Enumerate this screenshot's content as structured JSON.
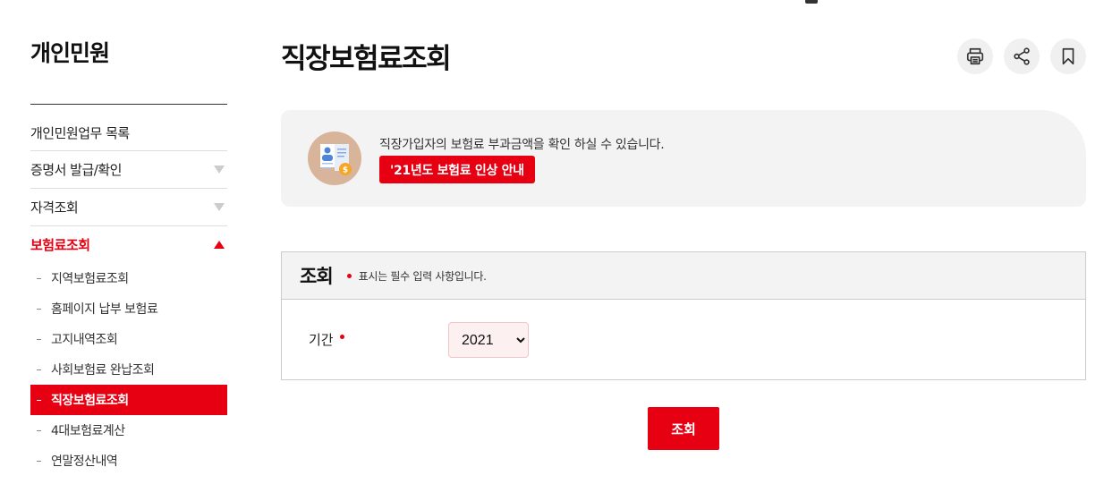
{
  "colors": {
    "accent": "#e60012",
    "panel": "#f3f3f3",
    "select_bg": "#fdf0f0"
  },
  "sidebar": {
    "title": "개인민원",
    "menu": [
      {
        "label": "개인민원업무 목록",
        "has_arrow": false
      },
      {
        "label": "증명서 발급/확인",
        "has_arrow": true
      },
      {
        "label": "자격조회",
        "has_arrow": true
      },
      {
        "label": "보험료조회",
        "has_arrow": true,
        "open": true
      }
    ],
    "submenu": [
      {
        "label": "지역보험료조회"
      },
      {
        "label": "홈페이지 납부 보험료"
      },
      {
        "label": "고지내역조회"
      },
      {
        "label": "사회보험료 완납조회"
      },
      {
        "label": "직장보험료조회",
        "active": true
      },
      {
        "label": "4대보험료계산"
      },
      {
        "label": "연말정산내역"
      }
    ]
  },
  "page": {
    "title": "직장보험료조회",
    "tools": {
      "print_icon": "printer-icon",
      "share_icon": "share-icon",
      "bookmark_icon": "bookmark-icon"
    }
  },
  "info": {
    "text": "직장가입자의 보험료 부과금액을 확인 하실 수 있습니다.",
    "button": "'21년도 보험료 인상 안내",
    "icon": "document-coin-icon"
  },
  "form": {
    "title": "조회",
    "required_note": "표시는 필수 입력 사항입니다.",
    "period_label": "기간",
    "period_value": "2021",
    "period_options": [
      "2021"
    ],
    "submit_label": "조회"
  }
}
